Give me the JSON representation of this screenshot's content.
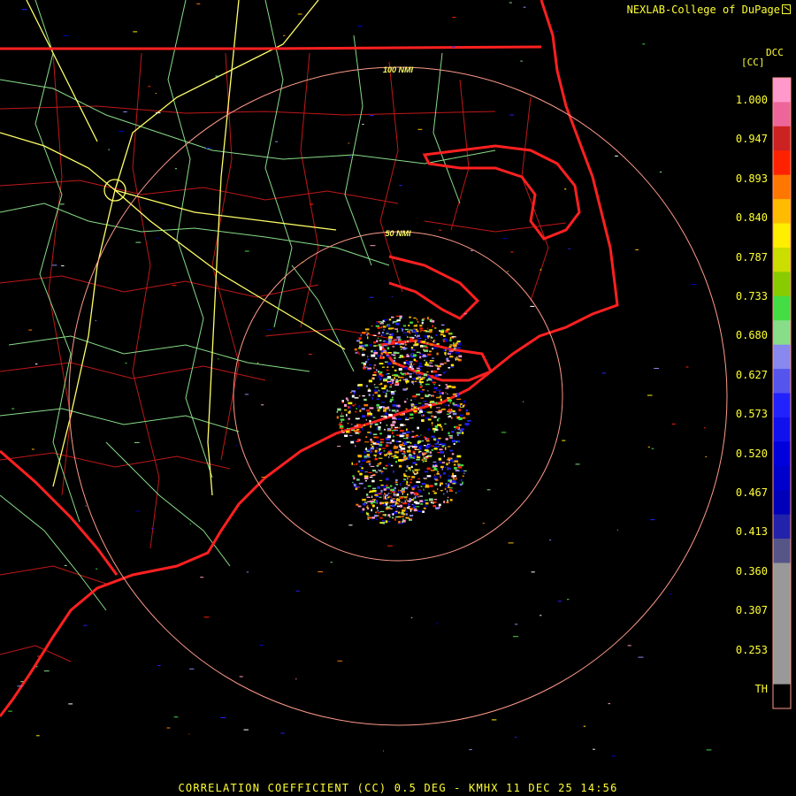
{
  "header": {
    "credit": "NEXLAB-College of DuPage",
    "credit_logo_icon": "nexlab-logo-icon"
  },
  "footer": {
    "caption": "CORRELATION COEFFICIENT (CC) 0.5 DEG - KMHX 11 DEC 25 14:56"
  },
  "map": {
    "range_rings": [
      {
        "label": "100 NMI"
      },
      {
        "label": "50 NMI"
      }
    ],
    "layers": [
      {
        "name": "state-borders",
        "color": "#ff2020"
      },
      {
        "name": "county-borders",
        "color": "#c01818"
      },
      {
        "name": "highways",
        "color": "#ffff66"
      },
      {
        "name": "roads",
        "color": "#88dd88"
      },
      {
        "name": "range-rings",
        "color": "#ff9a8a"
      }
    ]
  },
  "legend": {
    "product": "DCC",
    "unit": "[CC]",
    "ticks": [
      "1.000",
      "0.947",
      "0.893",
      "0.840",
      "0.787",
      "0.733",
      "0.680",
      "0.627",
      "0.573",
      "0.520",
      "0.467",
      "0.413",
      "0.360",
      "0.307",
      "0.253",
      "TH"
    ],
    "colors": [
      "#ff99cc",
      "#ee6699",
      "#cc2222",
      "#ff2200",
      "#ff7700",
      "#ffbb00",
      "#ffee00",
      "#ccdd00",
      "#88cc00",
      "#44dd44",
      "#88dd88",
      "#8888ee",
      "#5555ee",
      "#2222ff",
      "#1111ee",
      "#0000dd",
      "#0000cc",
      "#0000bb",
      "#2222aa",
      "#555588",
      "#999999",
      "#999999",
      "#999999",
      "#999999",
      "#999999",
      "#000000"
    ]
  }
}
